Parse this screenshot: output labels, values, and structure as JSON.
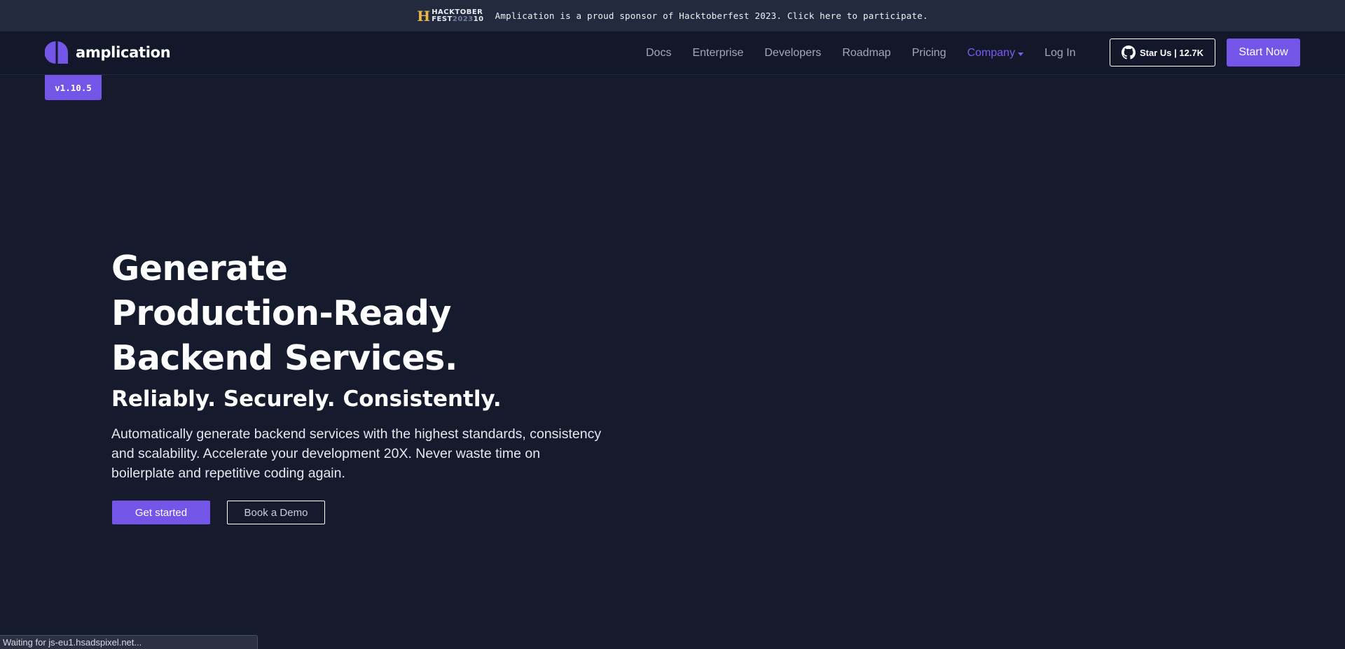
{
  "promo": {
    "logo_line1": "HACKTOBER",
    "logo_line2_a": "FEST",
    "logo_line2_b": "2023",
    "logo_line2_c": "10",
    "text": "Amplication is a proud sponsor of Hacktoberfest 2023.  Click here to participate."
  },
  "header": {
    "brand": "amplication",
    "nav": [
      {
        "label": "Docs"
      },
      {
        "label": "Enterprise"
      },
      {
        "label": "Developers"
      },
      {
        "label": "Roadmap"
      },
      {
        "label": "Pricing"
      },
      {
        "label": "Company",
        "active": true
      },
      {
        "label": "Log In"
      }
    ],
    "star_label": "Star Us | 12.7K",
    "start_label": "Start Now"
  },
  "version": "v1.10.5",
  "hero": {
    "title_lines": [
      "Generate",
      "Production-Ready",
      "Backend Services."
    ],
    "subtitle": "Reliably. Securely. Consistently.",
    "description": "Automatically generate backend services with the highest standards, consistency and scalability. Accelerate your development 20X. Never waste time on boilerplate and repetitive coding again.",
    "primary_cta": "Get started",
    "secondary_cta": "Book a Demo"
  },
  "status_bar": "Waiting for js-eu1.hsadspixel.net...",
  "colors": {
    "accent": "#7356e8",
    "background": "#151a2c",
    "banner": "#232a3e"
  }
}
